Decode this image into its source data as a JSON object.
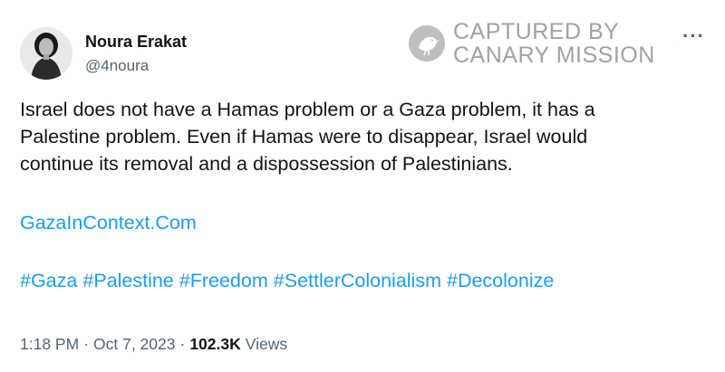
{
  "author": {
    "display_name": "Noura Erakat",
    "handle": "@4noura"
  },
  "watermark": {
    "line1": "CAPTURED BY",
    "line2": "CANARY MISSION",
    "icon": "bird-icon"
  },
  "more_icon": "more-options-icon",
  "tweet": {
    "text_lines": [
      "Israel does not have a Hamas problem or a Gaza problem, it has a",
      "Palestine problem. Even if Hamas were to disappear, Israel would",
      "continue its removal and a dispossession of Palestinians."
    ],
    "link": "GazaInContext.Com",
    "hashtags": [
      "#Gaza",
      "#Palestine",
      "#Freedom",
      "#SettlerColonialism",
      "#Decolonize"
    ]
  },
  "meta": {
    "time": "1:18 PM",
    "separator": "·",
    "date": "Oct 7, 2023",
    "views_count": "102.3K",
    "views_label": "Views"
  },
  "colors": {
    "link": "#1d9bf0",
    "secondary_text": "#536471",
    "primary_text": "#0f1419"
  }
}
